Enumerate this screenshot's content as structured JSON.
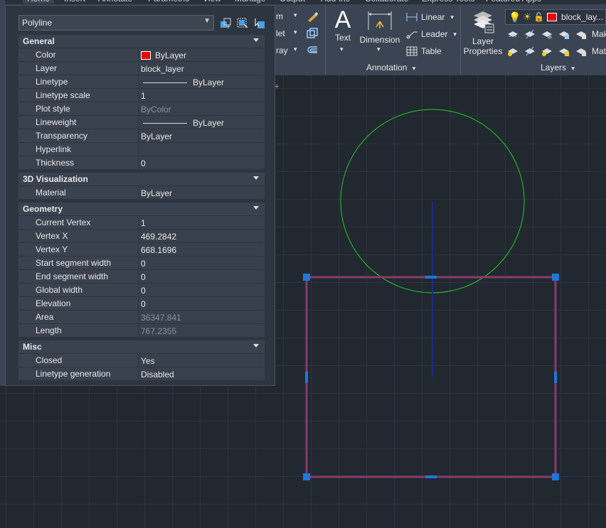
{
  "ribbon": {
    "tabs": [
      "Home",
      "Insert",
      "Annotate",
      "Parametric",
      "View",
      "Manage",
      "Output",
      "Add-ins",
      "Collaborate",
      "Express Tools",
      "Featured Apps"
    ],
    "left_fragments": [
      "m",
      "let",
      "ray"
    ],
    "annotation": {
      "text_label": "Text",
      "dimension_label": "Dimension",
      "linear_label": "Linear",
      "leader_label": "Leader",
      "table_label": "Table",
      "footer": "Annotation"
    },
    "layers": {
      "layer_properties_line1": "Layer",
      "layer_properties_line2": "Properties",
      "current_layer": "block_lay...",
      "make_label": "Mak",
      "match_label": "Mat",
      "footer": "Layers"
    }
  },
  "palette": {
    "selector_value": "Polyline",
    "sections": [
      {
        "title": "General",
        "rows": [
          {
            "key": "Color",
            "value": "ByLayer",
            "swatch": "red"
          },
          {
            "key": "Layer",
            "value": "block_layer"
          },
          {
            "key": "Linetype",
            "value": "ByLayer",
            "swatch": "line"
          },
          {
            "key": "Linetype scale",
            "value": "1"
          },
          {
            "key": "Plot style",
            "value": "ByColor",
            "dim": true
          },
          {
            "key": "Lineweight",
            "value": "ByLayer",
            "swatch": "line"
          },
          {
            "key": "Transparency",
            "value": "ByLayer"
          },
          {
            "key": "Hyperlink",
            "value": ""
          },
          {
            "key": "Thickness",
            "value": "0"
          }
        ]
      },
      {
        "title": "3D Visualization",
        "rows": [
          {
            "key": "Material",
            "value": "ByLayer"
          }
        ]
      },
      {
        "title": "Geometry",
        "rows": [
          {
            "key": "Current Vertex",
            "value": "1"
          },
          {
            "key": "Vertex X",
            "value": "469.2842"
          },
          {
            "key": "Vertex Y",
            "value": "668.1696"
          },
          {
            "key": "Start segment width",
            "value": "0"
          },
          {
            "key": "End segment width",
            "value": "0"
          },
          {
            "key": "Global width",
            "value": "0"
          },
          {
            "key": "Elevation",
            "value": "0"
          },
          {
            "key": "Area",
            "value": "36347.841",
            "dim": true
          },
          {
            "key": "Length",
            "value": "767.2355",
            "dim": true
          }
        ]
      },
      {
        "title": "Misc",
        "rows": [
          {
            "key": "Closed",
            "value": "Yes"
          },
          {
            "key": "Linetype generation",
            "value": "Disabled"
          }
        ]
      }
    ]
  },
  "colors": {
    "circle": "#22cc22",
    "polyline": "#8a3a6a",
    "grip": "#1e78d8",
    "axis": "#1a2aa8",
    "layer_swatch": "#ee0000"
  }
}
